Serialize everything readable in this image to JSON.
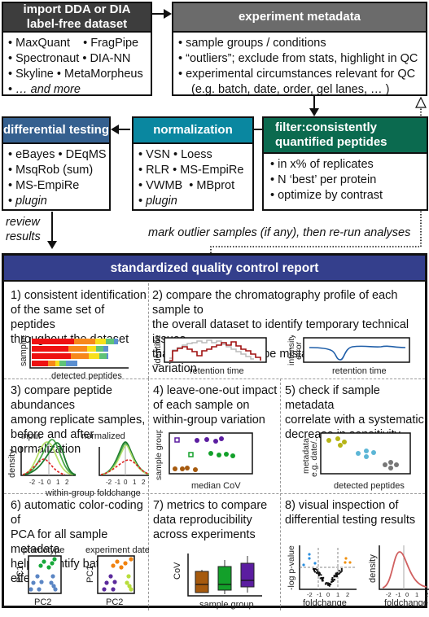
{
  "import_box": {
    "title_line1": "import DDA or DIA",
    "title_line2": "label-free dataset",
    "items": [
      [
        "MaxQuant",
        "FragPipe"
      ],
      [
        "Spectronaut",
        "DIA-NN"
      ],
      [
        "Skyline",
        "MetaMorpheus"
      ],
      [
        "… and more"
      ]
    ],
    "header_color": "#3d3d3d"
  },
  "metadata_box": {
    "title": "experiment metadata",
    "items": [
      "sample groups / conditions",
      "“outliers”; exclude from stats, highlight in QC",
      "experimental circumstances relevant for QC",
      "(e.g. batch, date, order, gel lanes, … )"
    ],
    "header_color": "#6b6b6b"
  },
  "filter_box": {
    "title_line1": "filter:consistently",
    "title_line2": "quantified peptides",
    "items": [
      "in x% of replicates",
      "N ‘best’ per protein",
      "optimize by contrast"
    ],
    "header_color": "#0b6a4f"
  },
  "normalization_box": {
    "title": "normalization",
    "items": [
      [
        "VSN",
        "Loess"
      ],
      [
        "RLR",
        "MS-EmpiRe"
      ],
      [
        "VWMB",
        "MBprot"
      ],
      [
        "plugin"
      ]
    ],
    "header_color": "#0a87a0"
  },
  "differential_box": {
    "title": "differential testing",
    "items": [
      [
        "eBayes",
        "DEqMS"
      ],
      [
        "MsqRob  (sum)"
      ],
      [
        "MS-EmpiRe"
      ],
      [
        "plugin"
      ]
    ],
    "header_color": "#35608f"
  },
  "review_label_line1": "review",
  "review_label_line2": "results",
  "rerun_label": "mark outlier samples (if any), then re-run analyses",
  "qc_report": {
    "title": "standardized quality control report",
    "header_color": "#343f8c",
    "panels": [
      {
        "text": [
          "1) consistent identification",
          "of the same set of peptides",
          "throughout the dataset"
        ],
        "ylabel": "samples",
        "xlabel": "detected peptides"
      },
      {
        "text": [
          "2) compare the chromatography profile of each sample to",
          "the overall dataset to identify temporary technical issues",
          "that would otherwise be mistaken for biological variation"
        ],
        "plot1_ylabel": "identified",
        "plot1_xlabel": "retention time",
        "plot2_ylabel1": "intensity",
        "plot2_ylabel2": "error",
        "plot2_xlabel": "retention time"
      },
      {
        "text": [
          "3) compare peptide abundances",
          "among replicate samples,",
          "before and after normalization"
        ],
        "plot1_title": "input",
        "plot2_title": "normalized",
        "ylabel": "density",
        "xlabel": "within-group foldchange",
        "ticks": [
          "-2",
          "-1",
          "0",
          "1",
          "2"
        ]
      },
      {
        "text": [
          "4) leave-one-out impact",
          "of each sample on",
          "within-group variation"
        ],
        "ylabel": "sample group",
        "xlabel": "median CoV"
      },
      {
        "text": [
          "5) check if sample metadata",
          "correlate with a systematic",
          "decrease in sensitivity"
        ],
        "ylabel1": "metadata",
        "ylabel2": "e.g. date/...",
        "xlabel": "detected peptides"
      },
      {
        "text": [
          "6) automatic color-coding of",
          "PCA for all sample metadata",
          "helps identify batch effects"
        ],
        "plot1_title": "phenotype",
        "plot2_title": "experiment date",
        "ylabel": "PC1",
        "xlabel": "PC2"
      },
      {
        "text": [
          "7) metrics to compare",
          "data reproducibility",
          "across experiments"
        ],
        "ylabel": "CoV",
        "xlabel": "sample group"
      },
      {
        "text": [
          "8) visual inspection of",
          "differential testing results"
        ],
        "plot1_ylabel": "-log p-value",
        "plot1_xlabel": "foldchange",
        "plot2_ylabel": "density",
        "plot2_xlabel": "foldchange",
        "ticks": [
          "-2",
          "-1",
          "0",
          "1",
          "2"
        ]
      }
    ]
  }
}
